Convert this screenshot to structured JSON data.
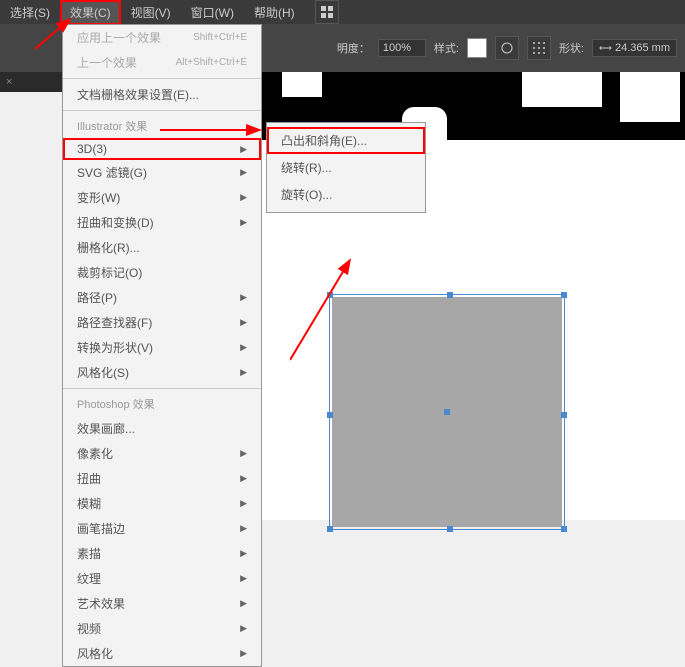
{
  "menubar": {
    "select": "选择(S)",
    "effect": "效果(C)",
    "view": "视图(V)",
    "window": "窗口(W)",
    "help": "帮助(H)"
  },
  "toolbar": {
    "opacity_label": "明度：",
    "opacity_value": "100%",
    "style_label": "样式:",
    "shape_label": "形状:",
    "shape_value": "24.365 mm"
  },
  "menu": {
    "apply_last": "应用上一个效果",
    "apply_last_shortcut": "Shift+Ctrl+E",
    "last_effect": "上一个效果",
    "last_effect_shortcut": "Alt+Shift+Ctrl+E",
    "doc_raster": "文档栅格效果设置(E)...",
    "illustrator_heading": "Illustrator 效果",
    "three_d": "3D(3)",
    "svg_filter": "SVG 滤镜(G)",
    "transform": "变形(W)",
    "distort": "扭曲和变换(D)",
    "rasterize": "栅格化(R)...",
    "crop_marks": "裁剪标记(O)",
    "path": "路径(P)",
    "pathfinder": "路径查找器(F)",
    "convert_shape": "转换为形状(V)",
    "stylize": "风格化(S)",
    "photoshop_heading": "Photoshop 效果",
    "effect_gallery": "效果画廊...",
    "pixelate": "像素化",
    "distort2": "扭曲",
    "blur": "模糊",
    "brush": "画笔描边",
    "sketch": "素描",
    "texture": "纹理",
    "artistic": "艺术效果",
    "video": "视频",
    "stylize2": "风格化"
  },
  "submenu": {
    "extrude": "凸出和斜角(E)...",
    "revolve": "绕转(R)...",
    "rotate": "旋转(O)..."
  },
  "tab": {
    "close": "×"
  }
}
